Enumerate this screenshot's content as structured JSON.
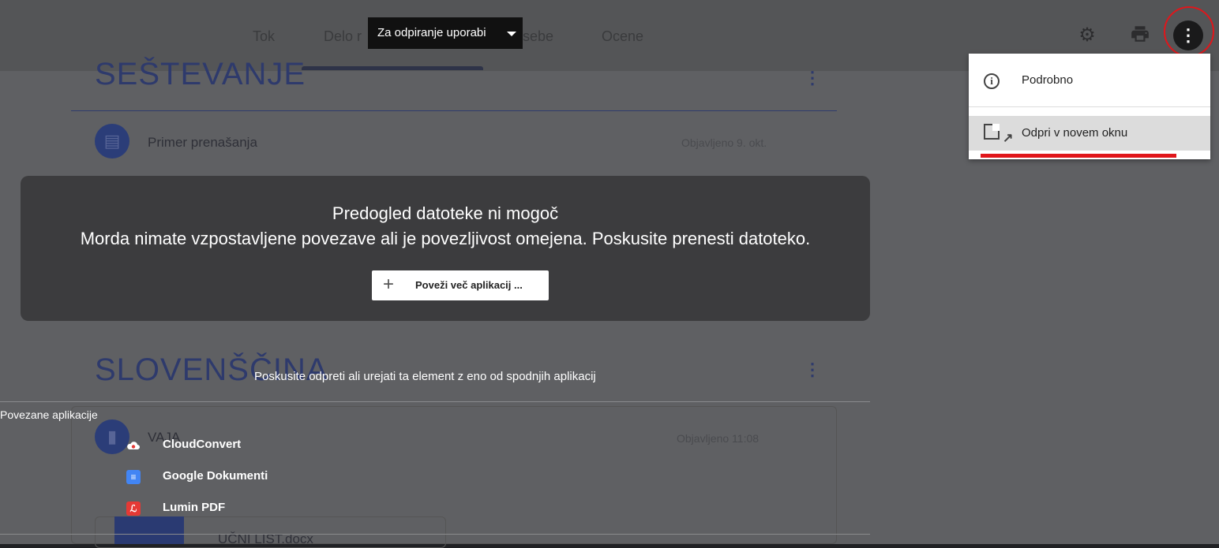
{
  "tabs": [
    "Tok",
    "Delo r",
    "sebe",
    "Ocene"
  ],
  "tooltip": "Za odpiranje uporabi",
  "sections": [
    {
      "title": "SEŠTEVANJE"
    },
    {
      "title": "SLOVENŠČINA"
    }
  ],
  "assignments": [
    {
      "title": "Primer prenašanja",
      "date": "Objavljeno 9. okt."
    },
    {
      "title": "VAJA",
      "date": "Objavljeno 11:08"
    }
  ],
  "file": {
    "name": "UČNI LIST.docx"
  },
  "preview": {
    "title": "Predogled datoteke ni mogoč",
    "message": "Morda nimate vzpostavljene povezave ali je povezljivost omejena. Poskusite prenesti datoteko.",
    "connect_label": "Poveži več aplikacij ..."
  },
  "apps": {
    "hint": "Poskusite odpreti ali urejati ta element z eno od spodnjih aplikacij",
    "section_label": "Povezane aplikacije",
    "items": [
      {
        "name": "CloudConvert",
        "color": "#ffffff",
        "icon": "cloud-icon"
      },
      {
        "name": "Google Dokumenti",
        "color": "#4285f4",
        "icon": "docs-icon"
      },
      {
        "name": "Lumin PDF",
        "color": "#e53935",
        "icon": "pdf-icon"
      }
    ]
  },
  "menu": {
    "items": [
      {
        "label": "Podrobno",
        "icon": "info-icon"
      },
      {
        "label": "Odpri v novem oknu",
        "icon": "open-in-new-icon"
      }
    ]
  },
  "colors": {
    "annotation": "#e0161b",
    "section": "#2e3a6c"
  }
}
